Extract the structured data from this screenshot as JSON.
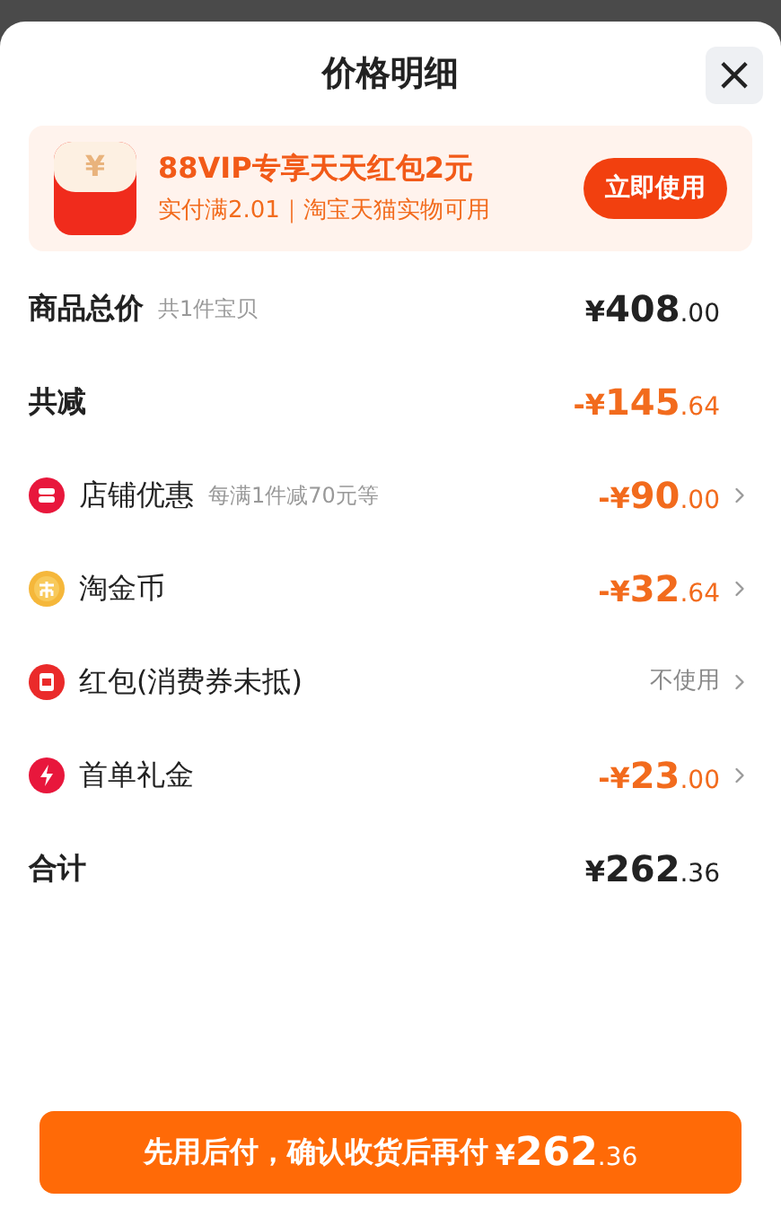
{
  "sheet": {
    "title": "价格明细",
    "close": "×"
  },
  "banner": {
    "icon": "¥",
    "title": "88VIP专享天天红包2元",
    "subtitle": "实付满2.01｜淘宝天猫实物可用",
    "button": "立即使用"
  },
  "rows": [
    {
      "kind": "plain",
      "label": "商品总价",
      "note": "共1件宝贝",
      "value": "¥408.00",
      "discount": false,
      "applied": true,
      "arrow": false
    },
    {
      "kind": "plain",
      "label": "共减",
      "value": "-¥145.64",
      "discount": true,
      "applied": true,
      "arrow": false
    },
    {
      "kind": "shop",
      "label": "店铺优惠",
      "note": "每满1件减70元等",
      "value": "-¥90.00",
      "discount": true,
      "applied": true,
      "arrow": true
    },
    {
      "kind": "coin",
      "label": "淘金币",
      "value": "-¥32.64",
      "discount": true,
      "applied": true,
      "arrow": true
    },
    {
      "kind": "redpacket",
      "label": "红包(消费券未抵)",
      "value": "不使用",
      "discount": false,
      "applied": false,
      "arrow": true
    },
    {
      "kind": "bolt",
      "label": "首单礼金",
      "value": "-¥23.00",
      "discount": true,
      "applied": true,
      "arrow": true
    },
    {
      "kind": "plain",
      "label": "合计",
      "value": "¥262.36",
      "discount": false,
      "applied": true,
      "arrow": false
    }
  ],
  "pay_button": {
    "label": "先用后付，确认收货后再付",
    "amount": "¥262.36"
  }
}
